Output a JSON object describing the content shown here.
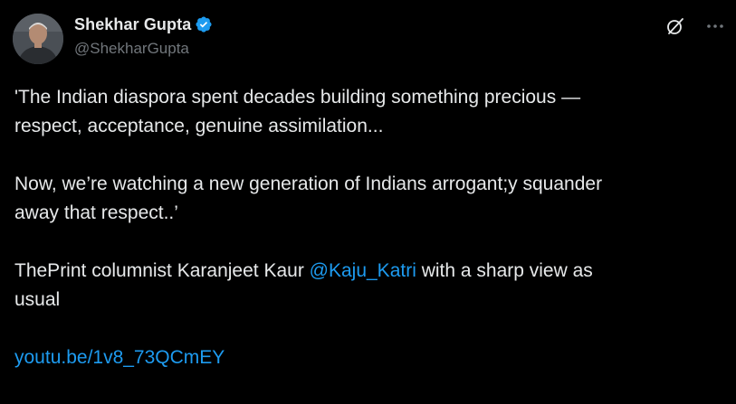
{
  "author": {
    "display_name": "Shekhar Gupta",
    "handle": "@ShekharGupta",
    "verified": true
  },
  "header_icons": [
    "grok-icon",
    "more-icon"
  ],
  "tweet": {
    "para1_line1": "'The Indian diaspora spent decades building something precious —",
    "para1_line2": "respect, acceptance, genuine assimilation...",
    "para2_line1": "Now, we’re watching a new generation of Indians arrogant;y squander",
    "para2_line2": "away that respect..’",
    "para3_prefix": "ThePrint columnist Karanjeet Kaur ",
    "mention": "@Kaju_Katri",
    "para3_suffix": " with a sharp view as",
    "para3_line2": "usual",
    "link": "youtu.be/1v8_73QCmEY"
  },
  "colors": {
    "background": "#000000",
    "text": "#e7e9ea",
    "secondary": "#71767b",
    "accent": "#1d9bf0"
  }
}
